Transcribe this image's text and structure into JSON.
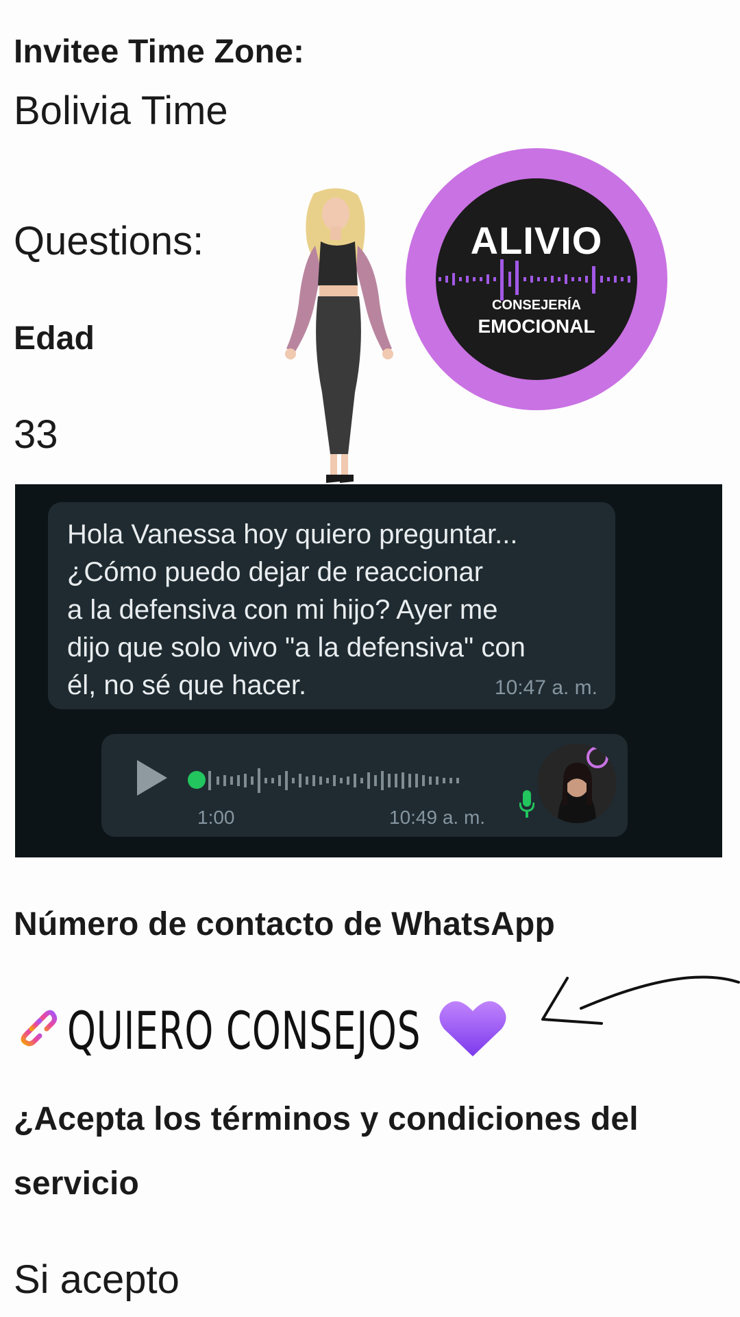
{
  "fields": {
    "timezone_label": "Invitee Time Zone:",
    "timezone_value": "Bolivia Time",
    "questions_label": "Questions:",
    "edad_label": "Edad",
    "edad_value": "33",
    "whatsapp_label": "Número de contacto de WhatsApp",
    "whatsapp_value": "QUIERO CONSEJOS",
    "terms_label_line1": "¿Acepta los términos y condiciones del",
    "terms_label_line2": "servicio",
    "terms_value": "Si acepto"
  },
  "logo": {
    "title": "ALIVIO",
    "subtitle1": "CONSEJERÍA",
    "subtitle2": "EMOCIONAL",
    "ring_color": "#c972e3"
  },
  "chat": {
    "message": "Hola Vanessa hoy quiero preguntar...\n¿Cómo puedo dejar de reaccionar\na la defensiva con mi hijo? Ayer me\ndijo que solo vivo \"a la defensiva\" con\nél, no sé que hacer.",
    "message_time": "10:47 a. m.",
    "audio_duration": "1:00",
    "audio_time": "10:49 a. m."
  },
  "icons": {
    "link": "link-icon",
    "heart": "purple-heart-icon",
    "arrow": "hand-drawn-arrow-icon",
    "play": "play-icon",
    "mic": "microphone-icon"
  },
  "colors": {
    "accent_purple": "#a259e6",
    "chat_bg": "#0d1417",
    "bubble_bg": "#1f2b31",
    "audio_green": "#22c55e"
  }
}
